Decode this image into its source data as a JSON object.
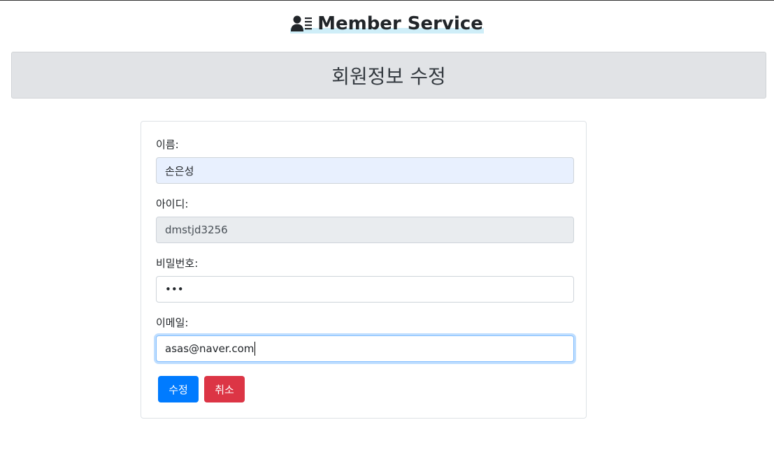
{
  "header": {
    "brand_title": "Member Service",
    "brand_icon": "user-list-icon"
  },
  "jumbotron": {
    "title": "회원정보 수정"
  },
  "form": {
    "name": {
      "label": "이름:",
      "value": "손은성"
    },
    "userid": {
      "label": "아이디:",
      "value": "dmstjd3256"
    },
    "password": {
      "label": "비밀번호:",
      "value": "•••"
    },
    "email": {
      "label": "이메일:",
      "value": "asas@naver.com"
    },
    "submit_label": "수정",
    "cancel_label": "취소"
  },
  "colors": {
    "primary": "#007bff",
    "danger": "#dc3545",
    "jumbotron_bg": "#e1e3e6",
    "autofill_bg": "#e8f0fe"
  }
}
